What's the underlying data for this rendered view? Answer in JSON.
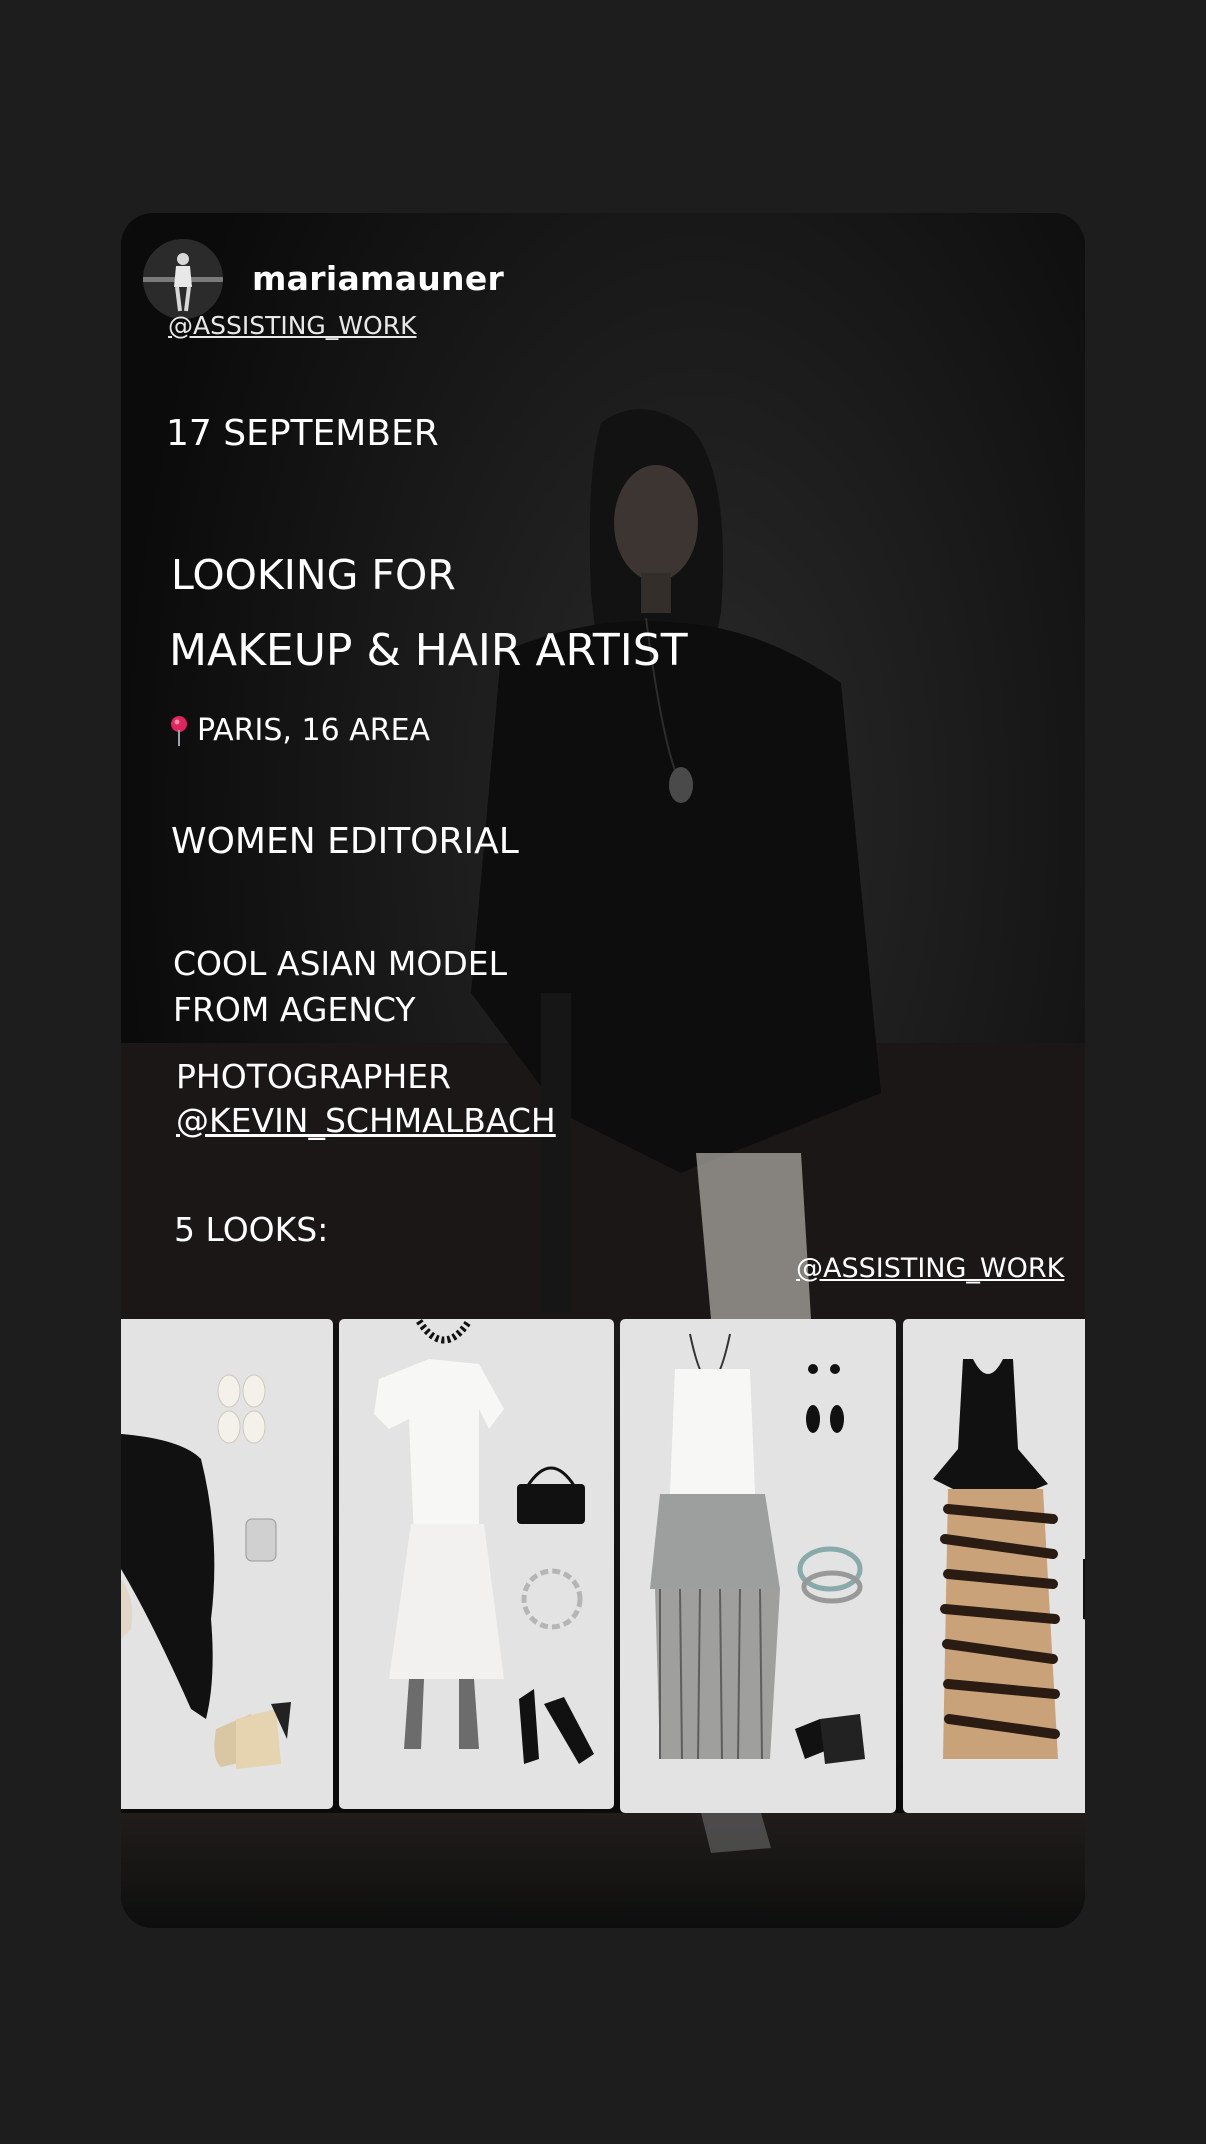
{
  "story": {
    "username": "mariamauner",
    "handle_top": "@ASSISTING_WORK",
    "date": "17 SEPTEMBER",
    "looking_for": "LOOKING FOR",
    "role": "MAKEUP & HAIR ARTIST",
    "location": "PARIS, 16 AREA",
    "category": "WOMEN EDITORIAL",
    "model_line1": "COOL ASIAN MODEL",
    "model_line2": "FROM AGENCY",
    "photographer_label": "PHOTOGRAPHER",
    "photographer_handle": "@KEVIN_SCHMALBACH",
    "looks": "5 LOOKS:",
    "handle_bottom": "@ASSISTING_WORK"
  },
  "icons": {
    "location": "pin-icon"
  },
  "colors": {
    "background": "#1d1d1d",
    "text": "#ffffff",
    "card": "#e3e3e3",
    "pin": "#e0245e"
  }
}
